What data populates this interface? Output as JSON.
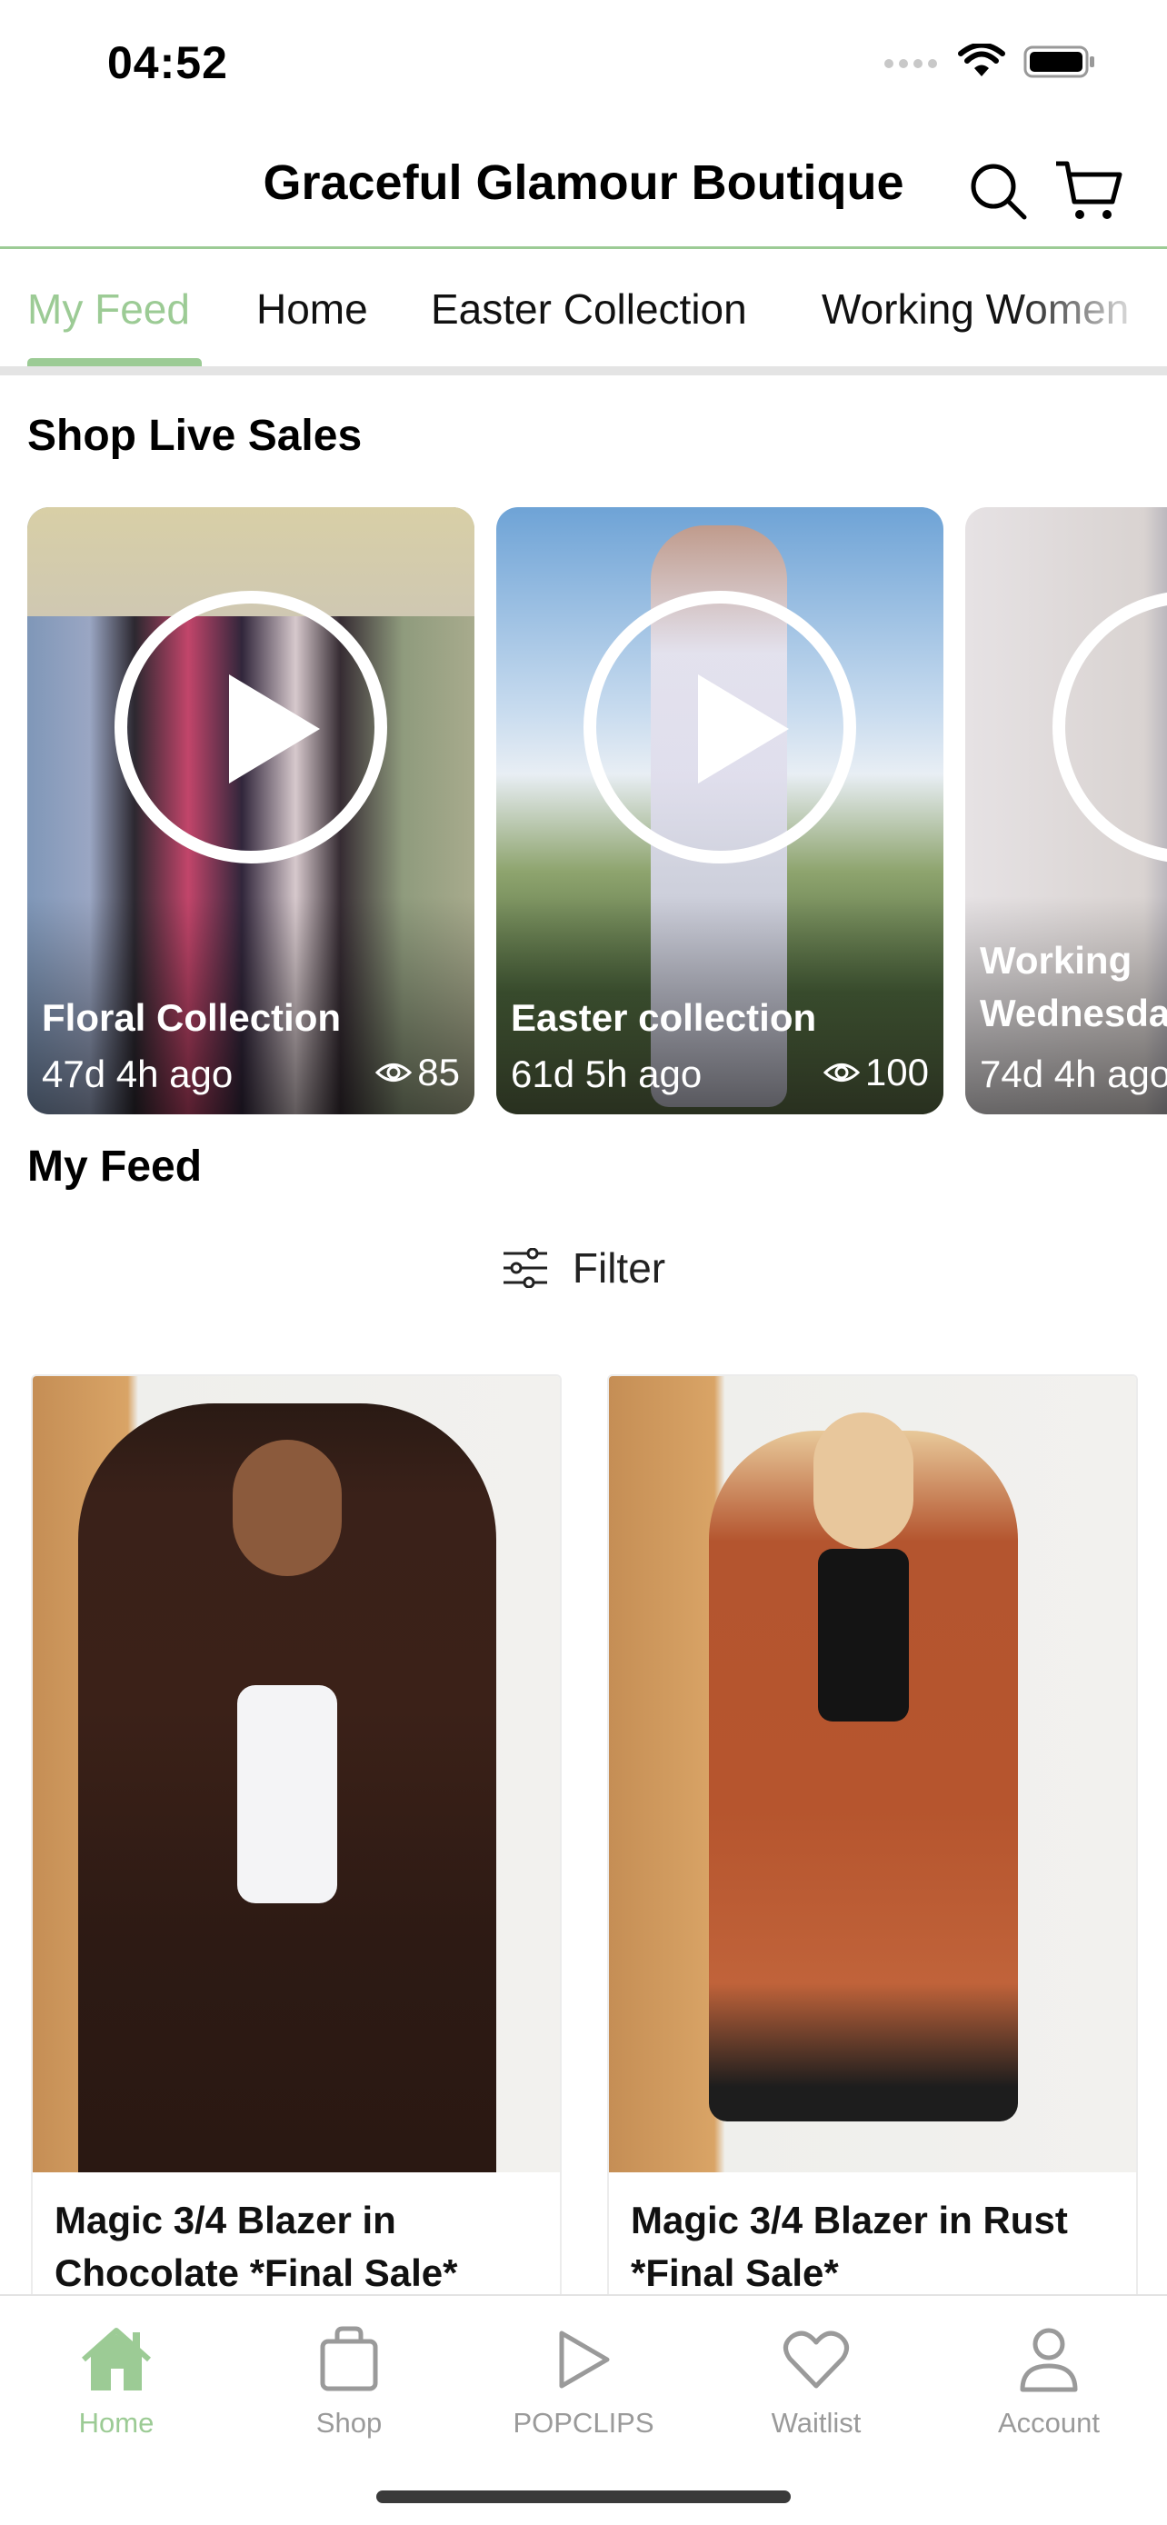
{
  "status_bar": {
    "time": "04:52"
  },
  "header": {
    "title": "Graceful Glamour Boutique"
  },
  "tabs": [
    {
      "label": "My Feed",
      "active": true
    },
    {
      "label": "Home"
    },
    {
      "label": "Easter Collection"
    },
    {
      "label": "Working Women"
    }
  ],
  "live_sales": {
    "title": "Shop Live Sales",
    "cards": [
      {
        "title": "Floral Collection",
        "ago": "47d 4h ago",
        "views": "85"
      },
      {
        "title": "Easter collection",
        "ago": "61d 5h ago",
        "views": "100"
      },
      {
        "title": "Working Wednesday",
        "ago": "74d 4h ago",
        "views": ""
      }
    ]
  },
  "feed": {
    "title": "My Feed",
    "filter_label": "Filter",
    "products": [
      {
        "name": "Magic 3/4 Blazer in Chocolate *Final Sale*"
      },
      {
        "name": "Magic 3/4 Blazer in Rust *Final Sale*"
      }
    ]
  },
  "tabbar": {
    "items": [
      {
        "label": "Home",
        "icon": "home-icon",
        "active": true
      },
      {
        "label": "Shop",
        "icon": "bag-icon"
      },
      {
        "label": "POPCLIPS",
        "icon": "play-icon"
      },
      {
        "label": "Waitlist",
        "icon": "heart-icon"
      },
      {
        "label": "Account",
        "icon": "person-icon"
      }
    ]
  },
  "colors": {
    "accent": "#9ccb95",
    "text": "#111111",
    "muted": "#9a9a9a"
  }
}
